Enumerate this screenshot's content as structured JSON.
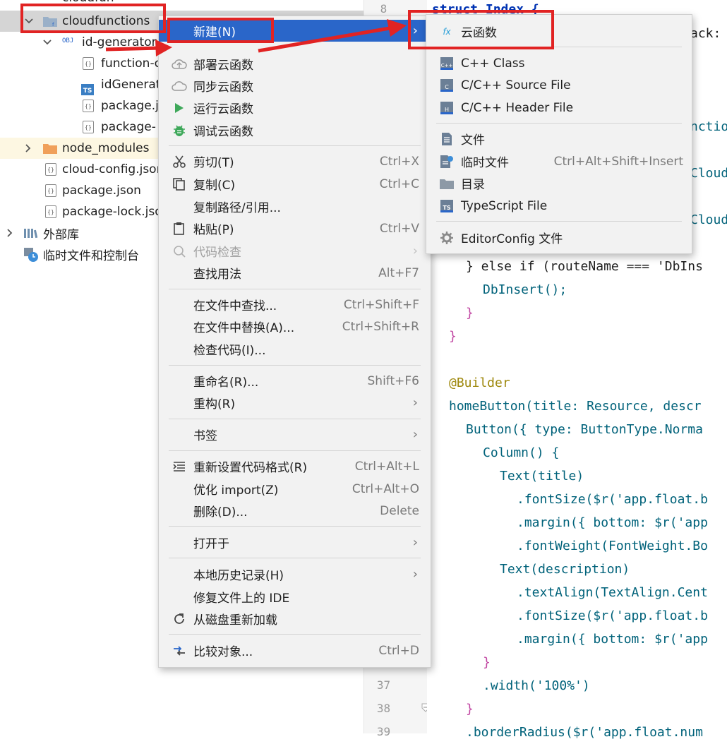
{
  "tree": {
    "items": [
      {
        "label": "cloudfunctions",
        "type": "folder"
      },
      {
        "label": "id-generator",
        "type": "obj-folder"
      },
      {
        "label": "function-c",
        "type": "json"
      },
      {
        "label": "idGenerat",
        "type": "ts"
      },
      {
        "label": "package.j",
        "type": "json"
      },
      {
        "label": "package-",
        "type": "json"
      },
      {
        "label": "node_modules",
        "type": "folder"
      },
      {
        "label": "cloud-config.json",
        "type": "json"
      },
      {
        "label": "package.json",
        "type": "json"
      },
      {
        "label": "package-lock.json",
        "type": "json"
      },
      {
        "label": "外部库",
        "type": "library"
      },
      {
        "label": "临时文件和控制台",
        "type": "scratch"
      }
    ],
    "partial_top": "cloudfun"
  },
  "gutter": {
    "line_numbers": [
      "8",
      "37",
      "38",
      "39"
    ]
  },
  "editor": {
    "lines": [
      "struct Index {",
      "ack:",
      "nctio",
      "Cloud",
      "Cloud",
      "} else if (routeName === 'DbIns",
      "DbInsert();",
      "}",
      "}",
      "@Builder",
      "homeButton(title: Resource, descr",
      "Button({ type: ButtonType.Norma",
      "Column() {",
      "Text(title)",
      ".fontSize($r('app.float.b",
      ".margin({ bottom: $r('app",
      ".fontWeight(FontWeight.Bo",
      "Text(description)",
      ".textAlign(TextAlign.Cent",
      ".fontSize($r('app.float.b",
      ".margin({ bottom: $r('app",
      "}",
      ".width('100%')",
      "}",
      ".borderRadius($r('app.float.num"
    ]
  },
  "context_menu": {
    "items": [
      {
        "label": "新建(N)",
        "shortcut": "",
        "icon": "none",
        "submenu": true,
        "active": true
      },
      {
        "label": "部署云函数",
        "shortcut": "",
        "icon": "cloud-upload-icon"
      },
      {
        "label": "同步云函数",
        "shortcut": "",
        "icon": "cloud-sync-icon"
      },
      {
        "label": "运行云函数",
        "shortcut": "",
        "icon": "run-icon"
      },
      {
        "label": "调试云函数",
        "shortcut": "",
        "icon": "debug-icon"
      },
      {
        "label": "剪切(T)",
        "shortcut": "Ctrl+X",
        "icon": "scissors-icon"
      },
      {
        "label": "复制(C)",
        "shortcut": "Ctrl+C",
        "icon": "copy-icon"
      },
      {
        "label": "复制路径/引用...",
        "shortcut": "",
        "icon": "none"
      },
      {
        "label": "粘贴(P)",
        "shortcut": "Ctrl+V",
        "icon": "paste-icon"
      },
      {
        "label": "代码检查",
        "shortcut": "",
        "icon": "inspect-icon",
        "submenu": true,
        "disabled": true
      },
      {
        "label": "查找用法",
        "shortcut": "Alt+F7",
        "icon": "none"
      },
      {
        "label": "在文件中查找...",
        "shortcut": "Ctrl+Shift+F",
        "icon": "none"
      },
      {
        "label": "在文件中替换(A)...",
        "shortcut": "Ctrl+Shift+R",
        "icon": "none"
      },
      {
        "label": "检查代码(I)...",
        "shortcut": "",
        "icon": "none"
      },
      {
        "label": "重命名(R)...",
        "shortcut": "Shift+F6",
        "icon": "none"
      },
      {
        "label": "重构(R)",
        "shortcut": "",
        "icon": "none",
        "submenu": true
      },
      {
        "label": "书签",
        "shortcut": "",
        "icon": "none",
        "submenu": true
      },
      {
        "label": "重新设置代码格式(R)",
        "shortcut": "Ctrl+Alt+L",
        "icon": "reformat-icon"
      },
      {
        "label": "优化 import(Z)",
        "shortcut": "Ctrl+Alt+O",
        "icon": "none"
      },
      {
        "label": "删除(D)...",
        "shortcut": "Delete",
        "icon": "none"
      },
      {
        "label": "打开于",
        "shortcut": "",
        "icon": "none",
        "submenu": true
      },
      {
        "label": "本地历史记录(H)",
        "shortcut": "",
        "icon": "none",
        "submenu": true
      },
      {
        "label": "修复文件上的 IDE",
        "shortcut": "",
        "icon": "none"
      },
      {
        "label": "从磁盘重新加载",
        "shortcut": "",
        "icon": "reload-icon"
      },
      {
        "label": "比较对象...",
        "shortcut": "Ctrl+D",
        "icon": "compare-icon"
      }
    ]
  },
  "submenu": {
    "items": [
      {
        "label": "云函数",
        "icon_text": "fx",
        "shortcut": ""
      },
      {
        "label": "C++ Class",
        "icon_text": "C++",
        "shortcut": ""
      },
      {
        "label": "C/C++ Source File",
        "icon_text": "C",
        "shortcut": ""
      },
      {
        "label": "C/C++ Header File",
        "icon_text": "H",
        "shortcut": ""
      },
      {
        "label": "文件",
        "icon_text": "",
        "shortcut": ""
      },
      {
        "label": "临时文件",
        "icon_text": "",
        "shortcut": "Ctrl+Alt+Shift+Insert"
      },
      {
        "label": "目录",
        "icon_text": "",
        "shortcut": ""
      },
      {
        "label": "TypeScript File",
        "icon_text": "TS",
        "shortcut": ""
      },
      {
        "label": "EditorConfig 文件",
        "icon_text": "",
        "shortcut": ""
      }
    ]
  },
  "colors": {
    "menu_active": "#2a66c9",
    "annotation_red": "#e12323",
    "folder_blue": "#9ab0c8",
    "folder_orange": "#f0a05a"
  }
}
